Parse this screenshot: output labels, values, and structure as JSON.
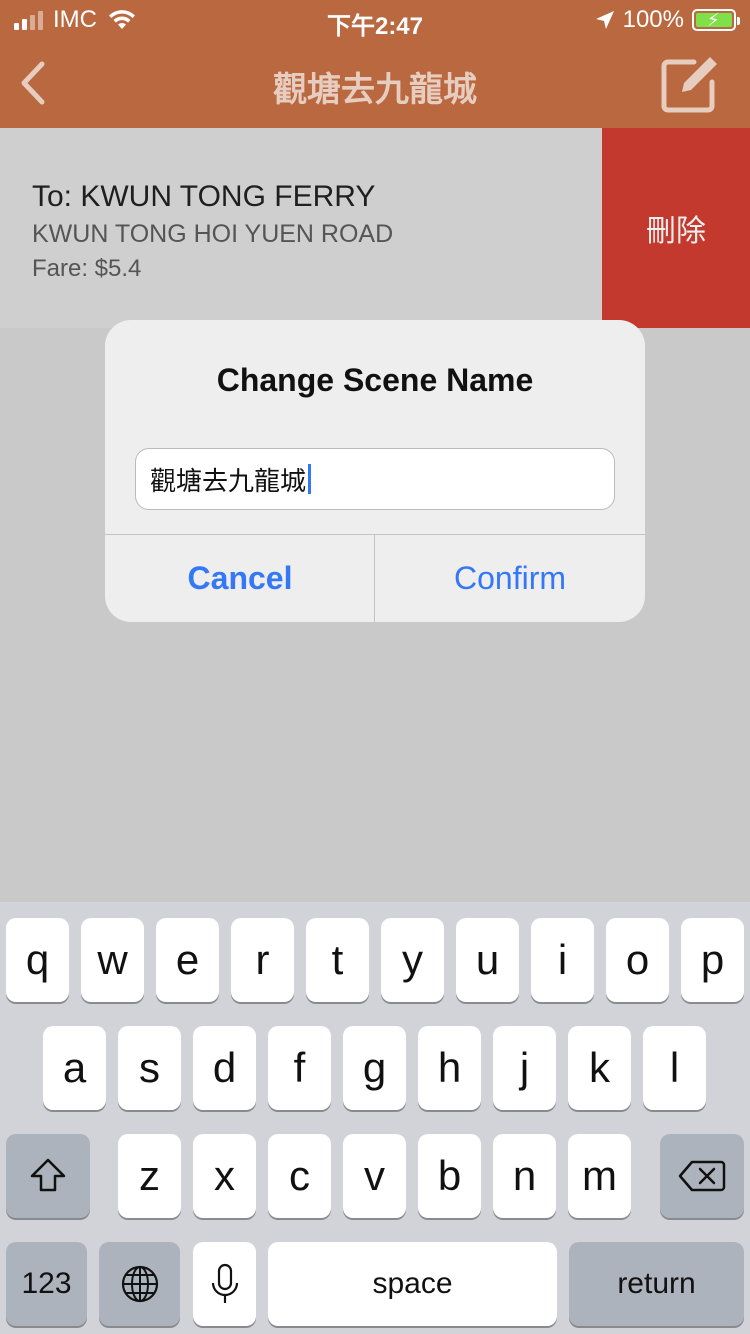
{
  "status_bar": {
    "carrier": "IMC",
    "time": "下午2:47",
    "battery": "100%"
  },
  "nav": {
    "title": "觀塘去九龍城",
    "back_icon": "chevron-left-icon",
    "edit_icon": "compose-icon"
  },
  "row": {
    "title": "To: KWUN TONG FERRY",
    "subtitle": "KWUN TONG HOI YUEN ROAD",
    "fare": "Fare: $5.4",
    "delete_label": "刪除"
  },
  "alert": {
    "title": "Change Scene Name",
    "input_value": "觀塘去九龍城",
    "cancel_label": "Cancel",
    "confirm_label": "Confirm"
  },
  "keyboard": {
    "row1": [
      "q",
      "w",
      "e",
      "r",
      "t",
      "y",
      "u",
      "i",
      "o",
      "p"
    ],
    "row2": [
      "a",
      "s",
      "d",
      "f",
      "g",
      "h",
      "j",
      "k",
      "l"
    ],
    "row3": [
      "z",
      "x",
      "c",
      "v",
      "b",
      "n",
      "m"
    ],
    "numbers_label": "123",
    "space_label": "space",
    "return_label": "return"
  },
  "colors": {
    "nav_bg": "#b9683f",
    "delete_bg": "#c4392d",
    "accent": "#3478f6"
  }
}
